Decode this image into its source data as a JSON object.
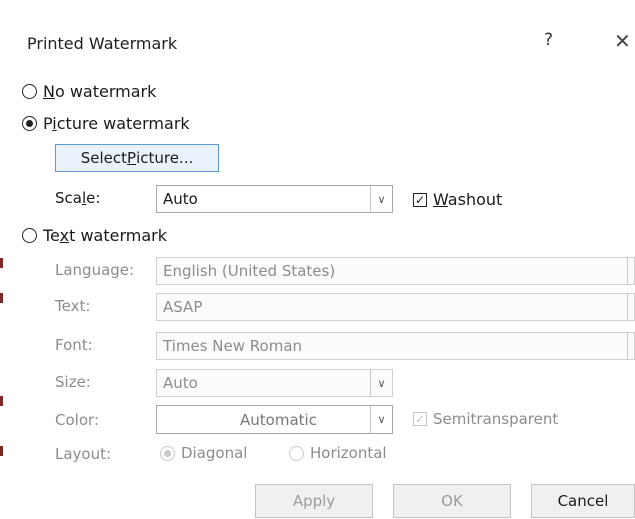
{
  "window": {
    "title": "Printed Watermark",
    "help_label": "?",
    "close_label": "✕"
  },
  "options": {
    "no_watermark": {
      "pre": "",
      "accel": "N",
      "post": "o watermark",
      "selected": false
    },
    "picture_watermark": {
      "pre": "P",
      "accel": "i",
      "post": "cture watermark",
      "selected": true
    },
    "text_watermark": {
      "pre": "Te",
      "accel": "x",
      "post": "t watermark",
      "selected": false
    }
  },
  "picture": {
    "select_button": {
      "pre": "Select ",
      "accel": "P",
      "post": "icture..."
    },
    "scale_label": {
      "pre": "Sca",
      "accel": "l",
      "post": "e:"
    },
    "scale_value": "Auto",
    "washout": {
      "pre": "",
      "accel": "W",
      "post": "ashout",
      "checked": true
    }
  },
  "text": {
    "language_label": "Language:",
    "language_value": "English (United States)",
    "text_label": "Text:",
    "text_value": "ASAP",
    "font_label": "Font:",
    "font_value": "Times New Roman",
    "size_label": "Size:",
    "size_value": "Auto",
    "color_label": "Color:",
    "color_value": "Automatic",
    "semitransparent_label": "Semitransparent",
    "semitransparent_checked": true,
    "layout_label": "Layout:",
    "layout_diagonal": "Diagonal",
    "layout_horizontal": "Horizontal",
    "layout_selected": "Diagonal"
  },
  "buttons": {
    "apply": "Apply",
    "ok": "OK",
    "cancel": "Cancel"
  },
  "colors": {
    "select_button_border": "#5b9bd5",
    "select_button_bg": "#e9f2fb",
    "disabled_text": "#8c8c8c"
  },
  "icons": {
    "radio": "radio-icon",
    "check": "check-icon",
    "chevron": "chevron-down-icon",
    "close": "close-icon",
    "help": "help-icon"
  }
}
